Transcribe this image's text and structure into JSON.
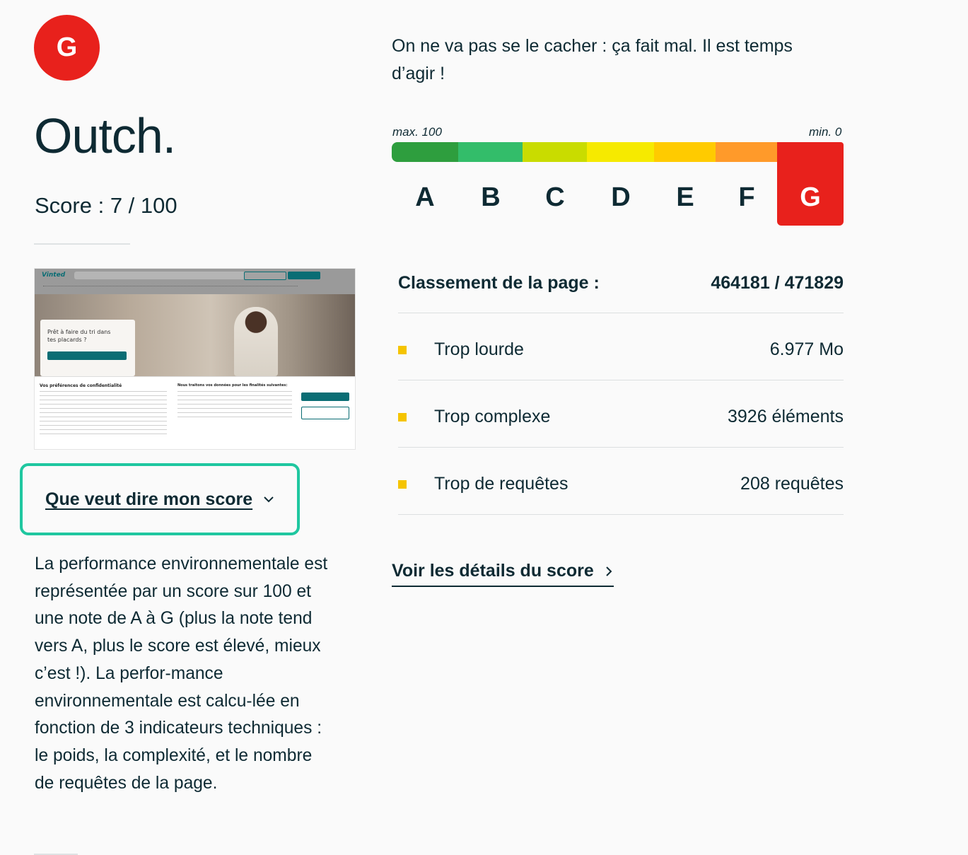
{
  "grade": "G",
  "headline": "Outch.",
  "score_text": "Score : 7 / 100",
  "intro": "On ne va pas se le cacher : ça fait mal. Il est temps d’agir !",
  "scale": {
    "max_label": "max. 100",
    "min_label": "min. 0",
    "grades": [
      "A",
      "B",
      "C",
      "D",
      "E",
      "F",
      "G"
    ],
    "active_grade": "G",
    "colors": [
      "#2e9e3e",
      "#33bd6a",
      "#c9dc00",
      "#f6ea00",
      "#ffcb00",
      "#ff9a2a",
      "#e8211c"
    ]
  },
  "thumbnail": {
    "site_logo": "Vinted",
    "hero_text": "Prêt à faire du tri dans tes placards ?",
    "cookie_title": "Vos préférences de confidentialité",
    "cookie_title_2": "Nous traitons vos données pour les finalités suivantes:"
  },
  "accordion": {
    "label": "Que veut dire mon score",
    "body": "La performance environnementale est représentée par un score sur 100 et une note de A à G (plus la note tend vers A, plus le score est élevé, mieux c’est !). La perfor-mance environnementale est calcu-lée en fonction de 3 indicateurs techniques : le poids, la complexité, et le nombre de requêtes de la page."
  },
  "ranking": {
    "label": "Classement de la page :",
    "value": "464181 / 471829"
  },
  "metrics": [
    {
      "label": "Trop lourde",
      "value": "6.977 Mo",
      "color": "#f5c400"
    },
    {
      "label": "Trop complexe",
      "value": "3926 éléments",
      "color": "#f5c400"
    },
    {
      "label": "Trop de requêtes",
      "value": "208 requêtes",
      "color": "#f5c400"
    }
  ],
  "details_link": "Voir les détails du score"
}
